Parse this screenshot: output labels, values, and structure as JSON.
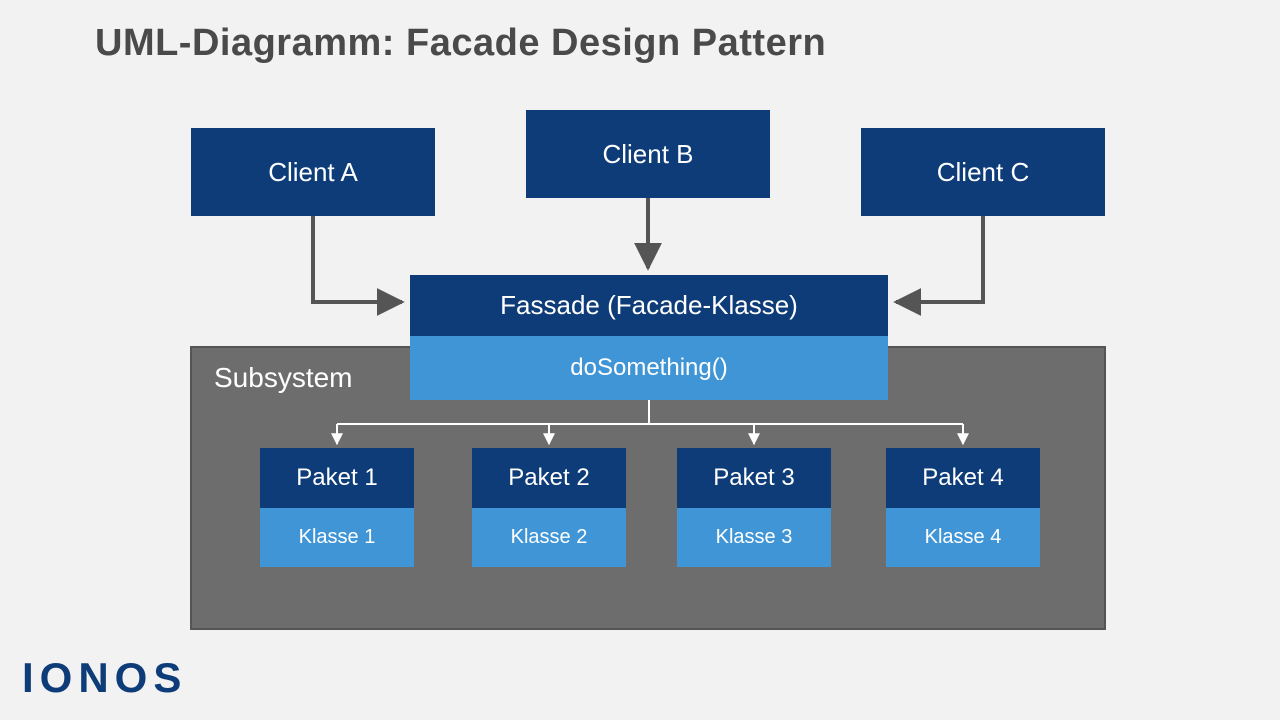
{
  "title": "UML-Diagramm: Facade Design Pattern",
  "clients": {
    "a": "Client A",
    "b": "Client B",
    "c": "Client C"
  },
  "facade": {
    "name": "Fassade (Facade-Klasse)",
    "method": "doSomething()"
  },
  "subsystem": {
    "label": "Subsystem",
    "packages": [
      {
        "name": "Paket 1",
        "class": "Klasse 1"
      },
      {
        "name": "Paket 2",
        "class": "Klasse 2"
      },
      {
        "name": "Paket 3",
        "class": "Klasse 3"
      },
      {
        "name": "Paket 4",
        "class": "Klasse 4"
      }
    ]
  },
  "logo": "IONOS",
  "colors": {
    "dark_blue": "#0d3c78",
    "light_blue": "#3f95d6",
    "gray_bg": "#6d6d6d",
    "page_bg": "#f2f2f2",
    "title_color": "#4a4a4a"
  }
}
